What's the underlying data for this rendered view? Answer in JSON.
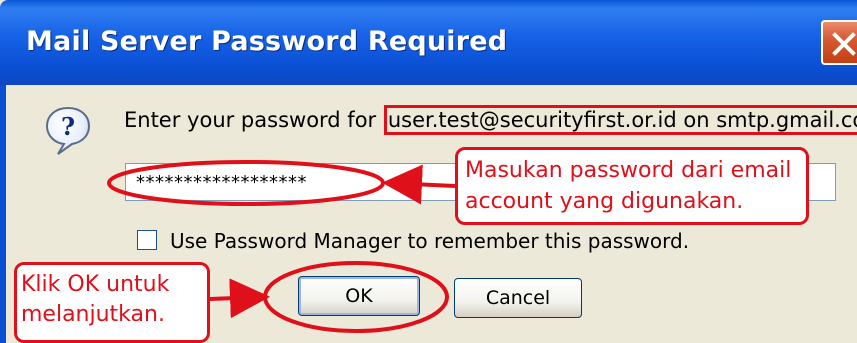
{
  "window": {
    "title": "Mail Server Password Required",
    "close_icon": "close-icon"
  },
  "prompt": {
    "icon": "question-icon",
    "text_prefix": "Enter your password for ",
    "account": "user.test@securityfirst.or.id on smtp.gmail.com:"
  },
  "password_field": {
    "value": "******************"
  },
  "remember_checkbox": {
    "checked": false,
    "label": "Use Password Manager to remember this password."
  },
  "buttons": {
    "ok_label": "OK",
    "cancel_label": "Cancel"
  },
  "annotations": {
    "password_note_line1": "Masukan password dari email",
    "password_note_line2": "account yang digunakan.",
    "ok_note_line1": "Klik OK untuk",
    "ok_note_line2": "melanjutkan.",
    "color": "#e0101b"
  },
  "colors": {
    "titlebar": "#0a4fd3",
    "dialog_bg": "#ece9d8",
    "annotation_red": "#e0101b"
  }
}
